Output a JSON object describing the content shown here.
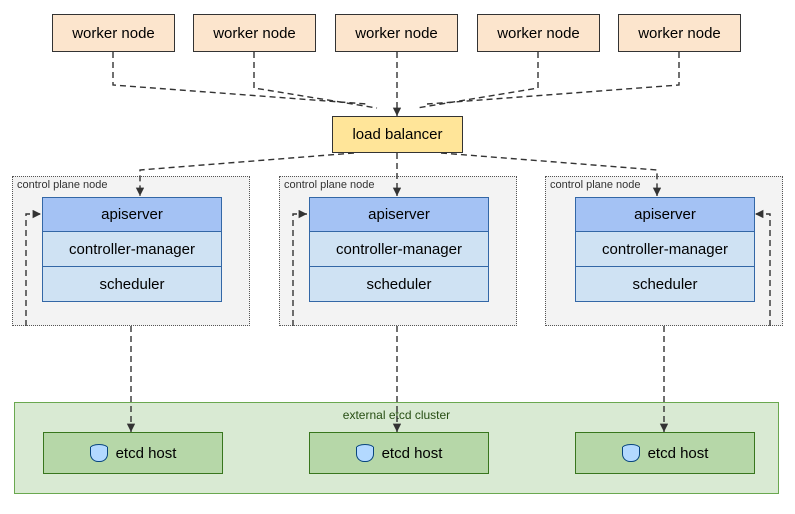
{
  "workers": [
    {
      "label": "worker node"
    },
    {
      "label": "worker node"
    },
    {
      "label": "worker node"
    },
    {
      "label": "worker node"
    },
    {
      "label": "worker node"
    }
  ],
  "load_balancer": {
    "label": "load balancer"
  },
  "control_planes": [
    {
      "group_label": "control plane node",
      "components": {
        "apiserver": "apiserver",
        "controller_manager": "controller-manager",
        "scheduler": "scheduler"
      }
    },
    {
      "group_label": "control plane node",
      "components": {
        "apiserver": "apiserver",
        "controller_manager": "controller-manager",
        "scheduler": "scheduler"
      }
    },
    {
      "group_label": "control plane node",
      "components": {
        "apiserver": "apiserver",
        "controller_manager": "controller-manager",
        "scheduler": "scheduler"
      }
    }
  ],
  "etcd_cluster": {
    "title": "external etcd cluster",
    "hosts": [
      {
        "label": "etcd host"
      },
      {
        "label": "etcd host"
      },
      {
        "label": "etcd host"
      }
    ]
  },
  "colors": {
    "worker_bg": "#fce5cd",
    "lb_bg": "#ffe599",
    "cp_group_bg": "#f3f3f3",
    "apiserver_bg": "#a4c2f4",
    "cp_component_bg": "#cfe2f3",
    "etcd_cluster_bg": "#d9ead3",
    "etcd_host_bg": "#b6d7a8"
  }
}
